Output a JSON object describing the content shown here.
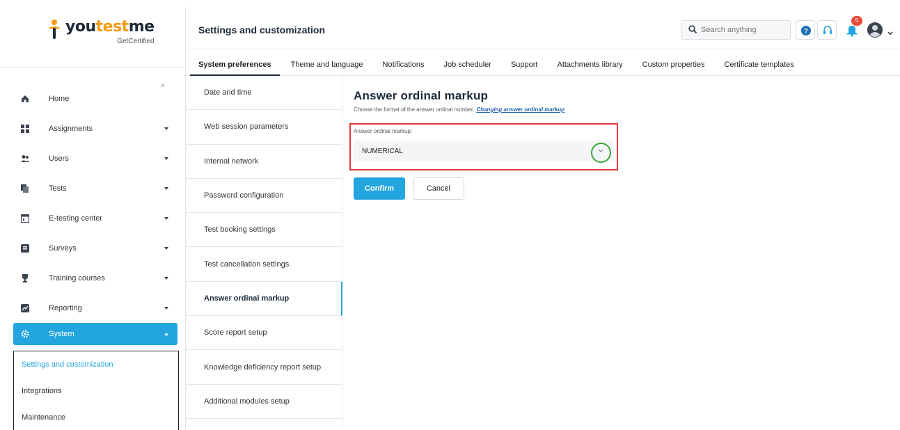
{
  "brand": {
    "name_prefix": "you",
    "name_accent": "test",
    "name_suffix": "me",
    "subtitle": "GetCertified"
  },
  "header": {
    "title": "Settings and customization",
    "search_placeholder": "Search anything",
    "notification_count": "5"
  },
  "sidebar": {
    "collapse_label": "«",
    "items": [
      {
        "label": "Home",
        "icon": "home-icon"
      },
      {
        "label": "Assignments",
        "icon": "assignments-icon"
      },
      {
        "label": "Users",
        "icon": "users-icon"
      },
      {
        "label": "Tests",
        "icon": "tests-icon"
      },
      {
        "label": "E-testing center",
        "icon": "e-testing-icon"
      },
      {
        "label": "Surveys",
        "icon": "surveys-icon"
      },
      {
        "label": "Training courses",
        "icon": "trophy-icon"
      },
      {
        "label": "Reporting",
        "icon": "reporting-icon"
      },
      {
        "label": "System",
        "icon": "gear-icon"
      }
    ],
    "sub_items": [
      "Settings and customization",
      "Integrations",
      "Maintenance"
    ]
  },
  "tabs": [
    "System preferences",
    "Theme and language",
    "Notifications",
    "Job scheduler",
    "Support",
    "Attachments library",
    "Custom properties",
    "Certificate templates"
  ],
  "settings_list": [
    "Date and time",
    "Web session parameters",
    "Internal network",
    "Password configuration",
    "Test booking settings",
    "Test cancellation settings",
    "Answer ordinal markup",
    "Score report setup",
    "Knowledge deficiency report setup",
    "Additional modules setup"
  ],
  "content": {
    "title": "Answer ordinal markup",
    "description": "Choose the format of the answer ordinal number.",
    "link": "Changing answer ordinal markup",
    "field_label": "Answer ordinal markup:",
    "field_value": "NUMERICAL",
    "confirm_label": "Confirm",
    "cancel_label": "Cancel"
  },
  "colors": {
    "accent": "#23a6df",
    "highlight_box": "#e53935",
    "circle": "#3aa83a",
    "badge": "#e74c3c"
  }
}
